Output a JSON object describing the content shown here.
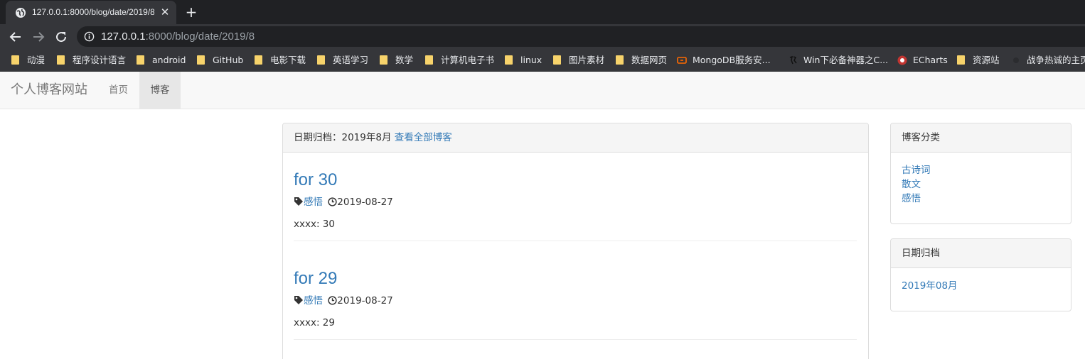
{
  "browser": {
    "tab_title": "127.0.0.1:8000/blog/date/2019/8",
    "new_tab": "+",
    "close": "✕",
    "url_host": "127.0.0.1",
    "url_path": ":8000/blog/date/2019/8",
    "bookmarks": [
      {
        "label": "动漫",
        "icon": "folder-icon"
      },
      {
        "label": "程序设计语言",
        "icon": "folder-icon"
      },
      {
        "label": "android",
        "icon": "folder-icon"
      },
      {
        "label": "GitHub",
        "icon": "folder-icon"
      },
      {
        "label": "电影下载",
        "icon": "folder-icon"
      },
      {
        "label": "英语学习",
        "icon": "folder-icon"
      },
      {
        "label": "数学",
        "icon": "folder-icon"
      },
      {
        "label": "计算机电子书",
        "icon": "folder-icon"
      },
      {
        "label": "linux",
        "icon": "folder-icon"
      },
      {
        "label": "图片素材",
        "icon": "folder-icon"
      },
      {
        "label": "数据网页",
        "icon": "folder-icon"
      },
      {
        "label": "MongoDB服务安...",
        "icon": "mongodb-favicon-icon"
      },
      {
        "label": "Win下必备神器之C...",
        "icon": "site-favicon-icon"
      },
      {
        "label": "ECharts",
        "icon": "echarts-favicon-icon"
      },
      {
        "label": "资源站",
        "icon": "folder-icon"
      },
      {
        "label": "战争热诚的主页",
        "icon": "site-favicon-icon"
      }
    ]
  },
  "navbar": {
    "brand": "个人博客网站",
    "items": [
      {
        "label": "首页",
        "active": false
      },
      {
        "label": "博客",
        "active": true
      }
    ]
  },
  "main": {
    "heading_prefix": "日期归档：2019年8月",
    "view_all_link": "查看全部博客",
    "posts": [
      {
        "title": "for 30",
        "category": "感悟",
        "date": "2019-08-27",
        "excerpt": "xxxx: 30"
      },
      {
        "title": "for 29",
        "category": "感悟",
        "date": "2019-08-27",
        "excerpt": "xxxx: 29"
      }
    ]
  },
  "sidebar": {
    "categories_title": "博客分类",
    "categories": [
      "古诗词",
      "散文",
      "感悟"
    ],
    "dates_title": "日期归档",
    "dates": [
      "2019年08月"
    ]
  },
  "colors": {
    "link": "#337ab7",
    "navbar_bg": "#f8f8f8",
    "chrome_dark": "#202124",
    "chrome_toolbar": "#35363a"
  }
}
